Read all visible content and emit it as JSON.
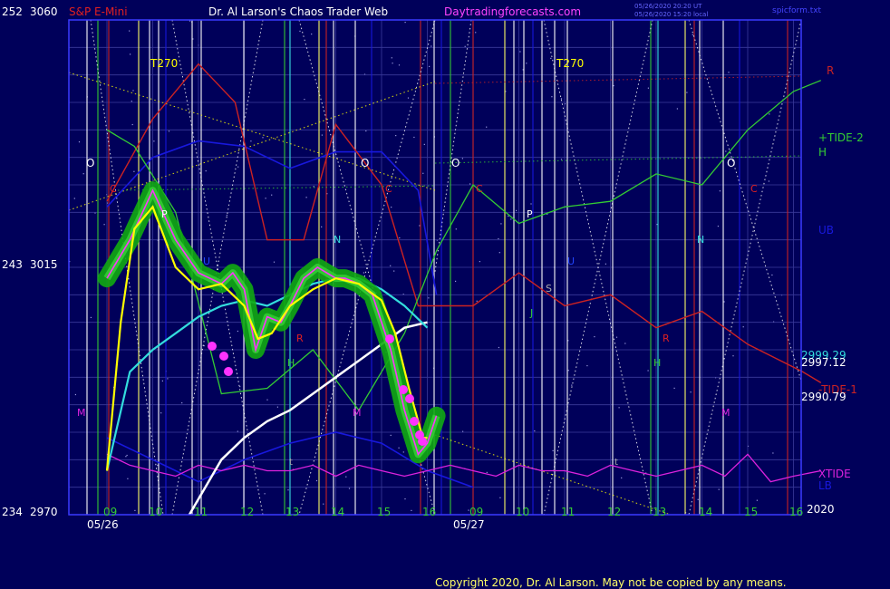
{
  "header": {
    "instrument": "S&P E-Mini",
    "author": "Dr. Al Larson's Chaos Trader Web",
    "site": "Daytradingforecasts.com",
    "stamp_line1": "05/26/2020 20:20 UT",
    "stamp_line2": "05/26/2020 15:20 local",
    "file": "spicform.txt"
  },
  "copyright": "Copyright 2020, Dr. Al Larson. May not be copied by any means.",
  "colors": {
    "background": "#00005a",
    "frame": "#3a3aff",
    "grid": "#3a3a9a",
    "price_green": "#33cc33",
    "price_glow": "#11aa11",
    "price_yellow": "#ffff00",
    "avg_cyan": "#33dddd",
    "avg_white": "#ffffff",
    "tide_red": "#cc2222",
    "band_blue": "#1818dd",
    "xtide_magenta": "#dd22dd",
    "pivot_magenta": "#ff33ff"
  },
  "chart_data": {
    "type": "line",
    "ylim": [
      2970,
      3060
    ],
    "y_left_ticks": [
      {
        "left": "252",
        "value": 3060,
        "label": "3060"
      },
      {
        "left": "243",
        "value": 3015,
        "label": "3015"
      },
      {
        "left": "234",
        "value": 2970,
        "label": "2970"
      }
    ],
    "x_tick_labels": [
      "09",
      "10",
      "11",
      "12",
      "13",
      "14",
      "15",
      "16",
      "09",
      "10",
      "11",
      "12",
      "13",
      "14",
      "15",
      "16"
    ],
    "day_labels": [
      "05/26",
      "05/27"
    ],
    "year_label": "2020",
    "legend": [
      {
        "label": "R",
        "color": "#cc2222"
      },
      {
        "label": "+TIDE-2",
        "color": "#33cc33"
      },
      {
        "label": "H",
        "color": "#33cc33"
      },
      {
        "label": "UB",
        "color": "#1818dd"
      },
      {
        "label": "-TIDE-1",
        "color": "#cc2222"
      },
      {
        "label": "XTIDE",
        "color": "#dd22dd"
      },
      {
        "label": "LB",
        "color": "#1818dd"
      }
    ],
    "right_values": [
      {
        "label": "2999.29",
        "color": "#33dddd"
      },
      {
        "label": "2997.12",
        "color": "#ffffff"
      },
      {
        "label": "2990.79",
        "color": "#ffffff"
      }
    ],
    "markers": [
      "T270",
      "T270",
      "O",
      "O",
      "O",
      "O",
      "C",
      "C",
      "C",
      "C",
      "P",
      "P",
      "U",
      "U",
      "N",
      "N",
      "R",
      "R",
      "H",
      "H",
      "J",
      "S",
      "M",
      "M",
      "M",
      "t",
      "t"
    ],
    "series": [
      {
        "key": "price",
        "x": [
          0,
          0.5,
          1,
          1.5,
          2,
          2.5,
          2.75,
          3,
          3.25,
          3.5,
          3.8,
          4,
          4.3,
          4.6,
          5,
          5.2,
          5.5,
          5.8,
          6,
          6.2,
          6.5,
          6.8,
          7,
          7.2
        ],
        "y": [
          3013,
          3020,
          3029,
          3020,
          3014,
          3012,
          3014,
          3011,
          3000,
          3006,
          3005,
          3008,
          3013,
          3015,
          3013,
          3013,
          3012,
          3010,
          3005,
          3000,
          2989,
          2981,
          2983,
          2988
        ]
      },
      {
        "key": "yellow_avg",
        "x": [
          0,
          0.3,
          0.6,
          1,
          1.5,
          2,
          2.5,
          3,
          3.3,
          3.6,
          4,
          4.5,
          5,
          5.5,
          6,
          6.3,
          6.6,
          6.9,
          7
        ],
        "y": [
          2978,
          3005,
          3022,
          3026,
          3015,
          3011,
          3012,
          3008,
          3002,
          3003,
          3008,
          3011,
          3013,
          3012,
          3009,
          3003,
          2993,
          2984,
          2984
        ]
      },
      {
        "key": "cyan_avg",
        "x": [
          0,
          0.5,
          1,
          1.5,
          2,
          2.5,
          3,
          3.5,
          4,
          4.5,
          5,
          5.5,
          6,
          6.5,
          7
        ],
        "y": [
          2978,
          2996,
          3000,
          3003,
          3006,
          3008,
          3009,
          3008,
          3010,
          3012,
          3013,
          3013,
          3011,
          3008,
          3004
        ]
      },
      {
        "key": "white_avg",
        "x": [
          1.8,
          2.5,
          3,
          3.5,
          4,
          4.5,
          5,
          5.5,
          6,
          6.5,
          7
        ],
        "y": [
          2970,
          2980,
          2984,
          2987,
          2989,
          2992,
          2995,
          2998,
          3001,
          3004,
          3005
        ]
      },
      {
        "key": "red_tide_1",
        "x": [
          0,
          1,
          2,
          2.8,
          3.5,
          4.3,
          5,
          6,
          6.8,
          8,
          9,
          10,
          11,
          12,
          13,
          14,
          15.2,
          15.6
        ],
        "y": [
          3027,
          3042,
          3052,
          3045,
          3020,
          3020,
          3041,
          3030,
          3008,
          3008,
          3014,
          3008,
          3010,
          3004,
          3007,
          3001,
          2996,
          2994
        ]
      },
      {
        "key": "green_tide_2",
        "x": [
          0,
          0.6,
          1.5,
          2.5,
          3.5,
          4.5,
          5.5,
          6.5,
          7.2,
          8,
          9,
          10,
          11,
          12,
          13,
          14,
          15,
          15.6
        ],
        "y": [
          3040,
          3037,
          3025,
          2992,
          2993,
          3000,
          2989,
          3003,
          3018,
          3030,
          3023,
          3026,
          3027,
          3032,
          3030,
          3040,
          3047,
          3049
        ]
      },
      {
        "key": "xtide",
        "x": [
          0,
          0.5,
          1,
          1.5,
          2,
          2.5,
          3,
          3.5,
          4,
          4.5,
          5,
          5.5,
          6,
          6.5,
          7,
          7.5,
          8,
          8.5,
          9,
          9.5,
          10,
          10.5,
          11,
          11.5,
          12,
          12.5,
          13,
          13.5,
          14,
          14.5,
          15,
          15.6
        ],
        "y": [
          2981,
          2979,
          2978,
          2977,
          2979,
          2978,
          2979,
          2978,
          2978,
          2979,
          2977,
          2979,
          2978,
          2977,
          2978,
          2979,
          2978,
          2977,
          2979,
          2978,
          2978,
          2977,
          2979,
          2978,
          2977,
          2978,
          2979,
          2977,
          2981,
          2976,
          2977,
          2978
        ]
      }
    ]
  }
}
